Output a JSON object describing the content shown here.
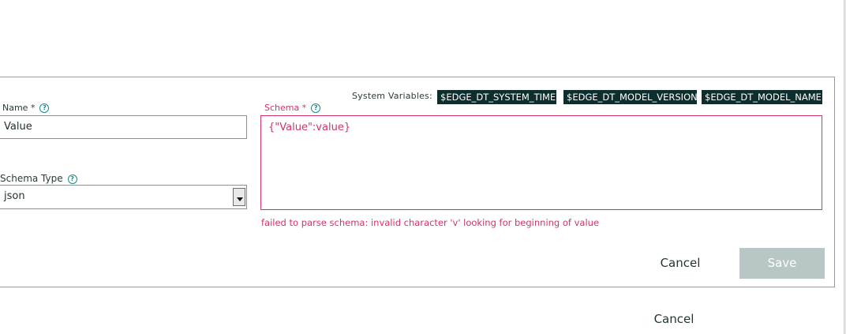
{
  "system_variables": {
    "label": "System Variables:",
    "items": [
      "$EDGE_DT_SYSTEM_TIME",
      "$EDGE_DT_MODEL_VERSION",
      "$EDGE_DT_MODEL_NAME"
    ]
  },
  "form": {
    "name_label": "Name *",
    "name_value": "Value",
    "schema_type_label": "Schema Type",
    "schema_type_value": "json",
    "schema_label": "Schema *",
    "schema_value": "{\"Value\":value}",
    "error": "failed to parse schema: invalid character 'v' looking for beginning of value",
    "help_glyph": "?"
  },
  "actions": {
    "cancel_label": "Cancel",
    "save_label": "Save"
  },
  "outer_actions": {
    "cancel_label": "Cancel"
  },
  "colors": {
    "chip_bg": "#0e2e2e",
    "error": "#d1336a",
    "save_disabled_bg": "#b8c6c6",
    "help_icon": "#178a8a"
  }
}
